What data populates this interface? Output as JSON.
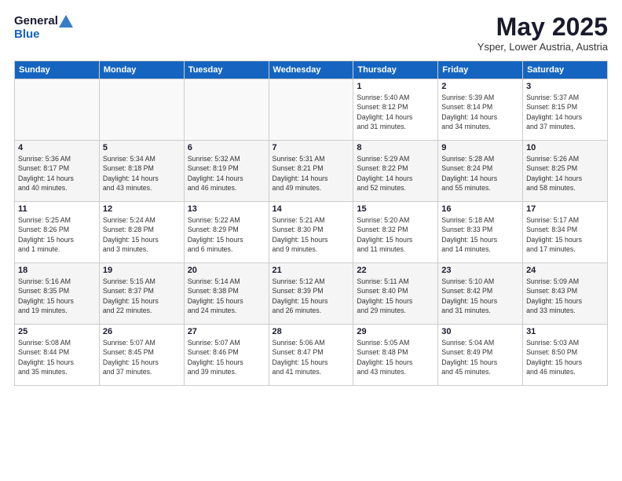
{
  "header": {
    "logo_general": "General",
    "logo_blue": "Blue",
    "title": "May 2025",
    "location": "Ysper, Lower Austria, Austria"
  },
  "weekdays": [
    "Sunday",
    "Monday",
    "Tuesday",
    "Wednesday",
    "Thursday",
    "Friday",
    "Saturday"
  ],
  "weeks": [
    [
      {
        "day": "",
        "info": ""
      },
      {
        "day": "",
        "info": ""
      },
      {
        "day": "",
        "info": ""
      },
      {
        "day": "",
        "info": ""
      },
      {
        "day": "1",
        "info": "Sunrise: 5:40 AM\nSunset: 8:12 PM\nDaylight: 14 hours\nand 31 minutes."
      },
      {
        "day": "2",
        "info": "Sunrise: 5:39 AM\nSunset: 8:14 PM\nDaylight: 14 hours\nand 34 minutes."
      },
      {
        "day": "3",
        "info": "Sunrise: 5:37 AM\nSunset: 8:15 PM\nDaylight: 14 hours\nand 37 minutes."
      }
    ],
    [
      {
        "day": "4",
        "info": "Sunrise: 5:36 AM\nSunset: 8:17 PM\nDaylight: 14 hours\nand 40 minutes."
      },
      {
        "day": "5",
        "info": "Sunrise: 5:34 AM\nSunset: 8:18 PM\nDaylight: 14 hours\nand 43 minutes."
      },
      {
        "day": "6",
        "info": "Sunrise: 5:32 AM\nSunset: 8:19 PM\nDaylight: 14 hours\nand 46 minutes."
      },
      {
        "day": "7",
        "info": "Sunrise: 5:31 AM\nSunset: 8:21 PM\nDaylight: 14 hours\nand 49 minutes."
      },
      {
        "day": "8",
        "info": "Sunrise: 5:29 AM\nSunset: 8:22 PM\nDaylight: 14 hours\nand 52 minutes."
      },
      {
        "day": "9",
        "info": "Sunrise: 5:28 AM\nSunset: 8:24 PM\nDaylight: 14 hours\nand 55 minutes."
      },
      {
        "day": "10",
        "info": "Sunrise: 5:26 AM\nSunset: 8:25 PM\nDaylight: 14 hours\nand 58 minutes."
      }
    ],
    [
      {
        "day": "11",
        "info": "Sunrise: 5:25 AM\nSunset: 8:26 PM\nDaylight: 15 hours\nand 1 minute."
      },
      {
        "day": "12",
        "info": "Sunrise: 5:24 AM\nSunset: 8:28 PM\nDaylight: 15 hours\nand 3 minutes."
      },
      {
        "day": "13",
        "info": "Sunrise: 5:22 AM\nSunset: 8:29 PM\nDaylight: 15 hours\nand 6 minutes."
      },
      {
        "day": "14",
        "info": "Sunrise: 5:21 AM\nSunset: 8:30 PM\nDaylight: 15 hours\nand 9 minutes."
      },
      {
        "day": "15",
        "info": "Sunrise: 5:20 AM\nSunset: 8:32 PM\nDaylight: 15 hours\nand 11 minutes."
      },
      {
        "day": "16",
        "info": "Sunrise: 5:18 AM\nSunset: 8:33 PM\nDaylight: 15 hours\nand 14 minutes."
      },
      {
        "day": "17",
        "info": "Sunrise: 5:17 AM\nSunset: 8:34 PM\nDaylight: 15 hours\nand 17 minutes."
      }
    ],
    [
      {
        "day": "18",
        "info": "Sunrise: 5:16 AM\nSunset: 8:35 PM\nDaylight: 15 hours\nand 19 minutes."
      },
      {
        "day": "19",
        "info": "Sunrise: 5:15 AM\nSunset: 8:37 PM\nDaylight: 15 hours\nand 22 minutes."
      },
      {
        "day": "20",
        "info": "Sunrise: 5:14 AM\nSunset: 8:38 PM\nDaylight: 15 hours\nand 24 minutes."
      },
      {
        "day": "21",
        "info": "Sunrise: 5:12 AM\nSunset: 8:39 PM\nDaylight: 15 hours\nand 26 minutes."
      },
      {
        "day": "22",
        "info": "Sunrise: 5:11 AM\nSunset: 8:40 PM\nDaylight: 15 hours\nand 29 minutes."
      },
      {
        "day": "23",
        "info": "Sunrise: 5:10 AM\nSunset: 8:42 PM\nDaylight: 15 hours\nand 31 minutes."
      },
      {
        "day": "24",
        "info": "Sunrise: 5:09 AM\nSunset: 8:43 PM\nDaylight: 15 hours\nand 33 minutes."
      }
    ],
    [
      {
        "day": "25",
        "info": "Sunrise: 5:08 AM\nSunset: 8:44 PM\nDaylight: 15 hours\nand 35 minutes."
      },
      {
        "day": "26",
        "info": "Sunrise: 5:07 AM\nSunset: 8:45 PM\nDaylight: 15 hours\nand 37 minutes."
      },
      {
        "day": "27",
        "info": "Sunrise: 5:07 AM\nSunset: 8:46 PM\nDaylight: 15 hours\nand 39 minutes."
      },
      {
        "day": "28",
        "info": "Sunrise: 5:06 AM\nSunset: 8:47 PM\nDaylight: 15 hours\nand 41 minutes."
      },
      {
        "day": "29",
        "info": "Sunrise: 5:05 AM\nSunset: 8:48 PM\nDaylight: 15 hours\nand 43 minutes."
      },
      {
        "day": "30",
        "info": "Sunrise: 5:04 AM\nSunset: 8:49 PM\nDaylight: 15 hours\nand 45 minutes."
      },
      {
        "day": "31",
        "info": "Sunrise: 5:03 AM\nSunset: 8:50 PM\nDaylight: 15 hours\nand 46 minutes."
      }
    ]
  ]
}
